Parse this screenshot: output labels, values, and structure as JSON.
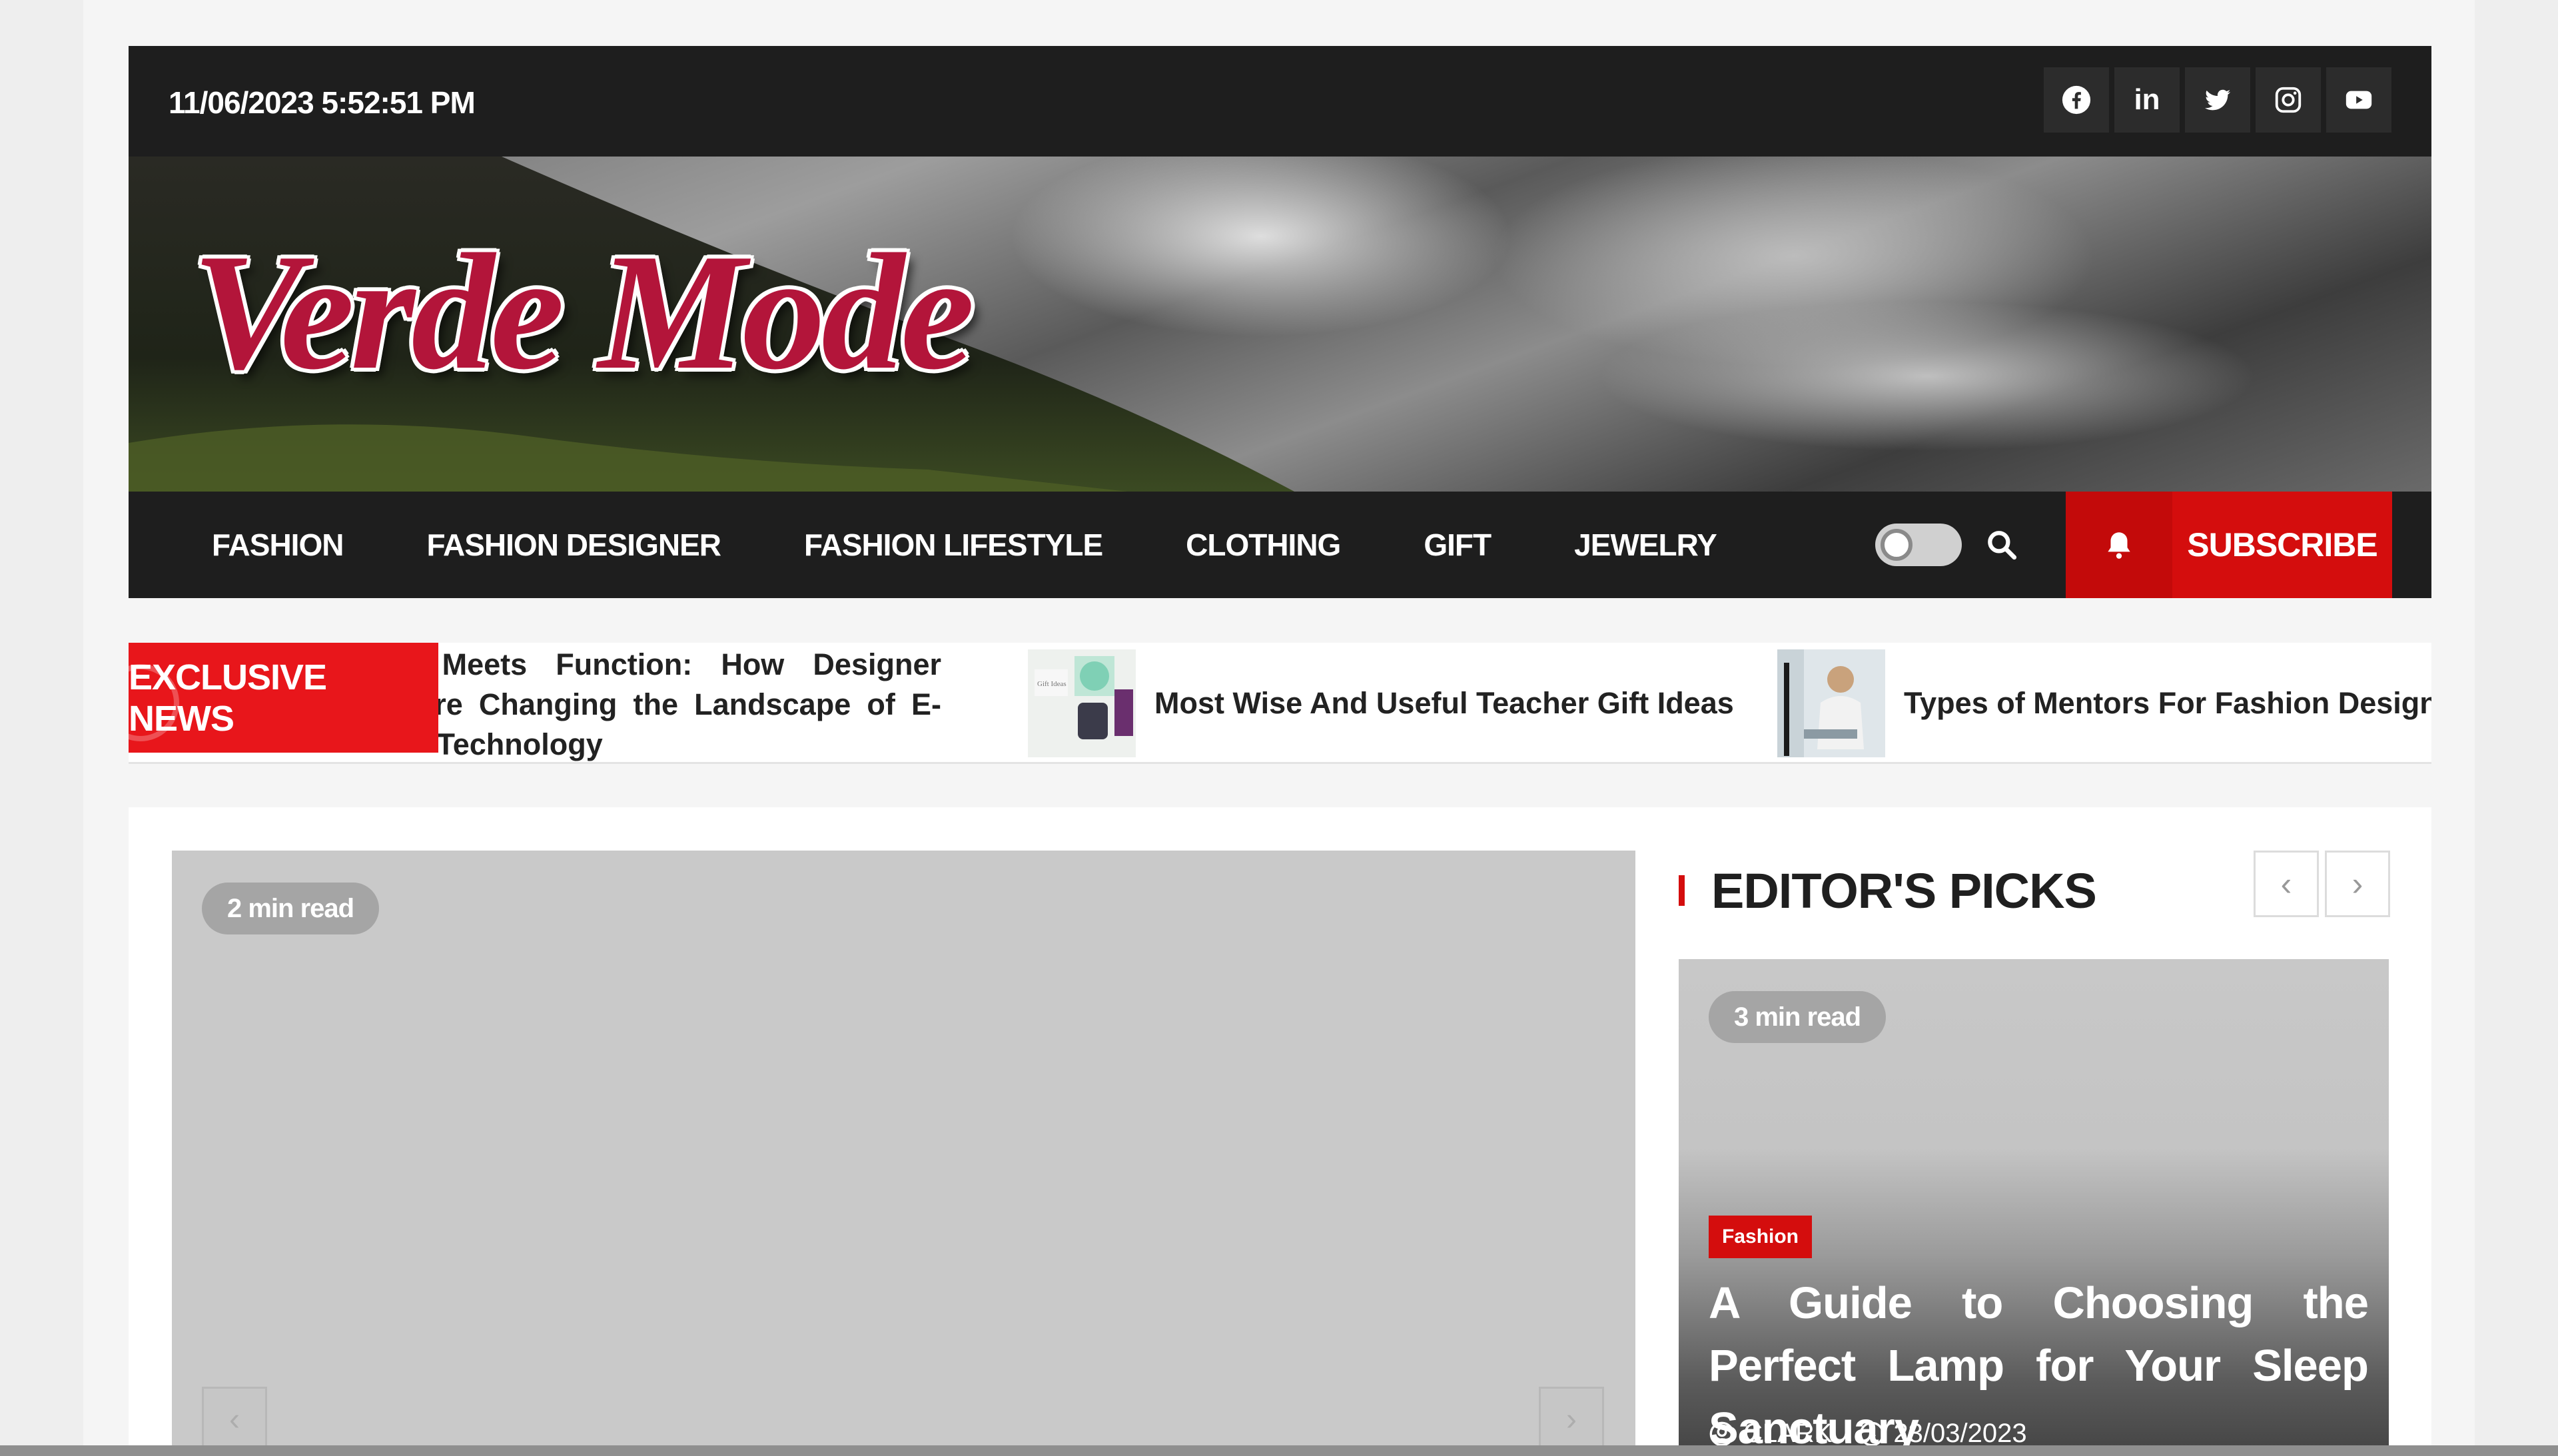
{
  "topbar": {
    "datetime": "11/06/2023 5:52:51 PM",
    "socials": [
      {
        "icon": "facebook-icon",
        "glyph": "f"
      },
      {
        "icon": "linkedin-icon",
        "glyph": "in"
      },
      {
        "icon": "twitter-icon",
        "glyph": ""
      },
      {
        "icon": "instagram-icon",
        "glyph": ""
      },
      {
        "icon": "youtube-icon",
        "glyph": ""
      }
    ]
  },
  "header": {
    "logo_text": "Verde Mode"
  },
  "nav": {
    "items": [
      "Fashion",
      "Fashion Designer",
      "Fashion Lifestyle",
      "Clothing",
      "Gift",
      "Jewelry"
    ],
    "subscribe_label": "Subscribe"
  },
  "ticker": {
    "label": "Exclusive News",
    "items": [
      {
        "title": "Fashion Meets Function: How Designer Brands are Changing the Landscape of E-Cigarette Technology"
      },
      {
        "title": "Most Wise And Useful Teacher Gift Ideas"
      },
      {
        "title": "Types of Mentors For Fashion Designers"
      }
    ]
  },
  "main_slider": {
    "read_time": "2 min read"
  },
  "editors_picks": {
    "heading": "Editor's Picks",
    "card": {
      "read_time": "3 min read",
      "category": "Fashion",
      "title": "A Guide to Choosing the Perfect Lamp for Your Sleep Sanctuary",
      "author": "CLARK",
      "date": "23/03/2023"
    }
  },
  "colors": {
    "accent": "#d40d0d",
    "ticker_label": "#e8161b",
    "dark_bar": "#1e1e1e",
    "logo": "#b3153a"
  }
}
